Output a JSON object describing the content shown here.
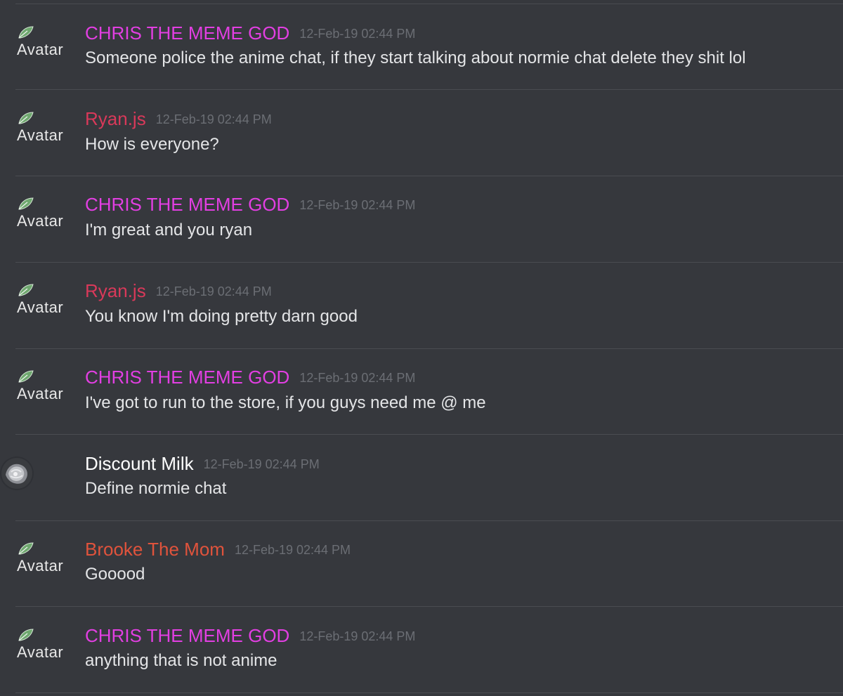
{
  "colors": {
    "background": "#36383d",
    "divider": "#4a4c51",
    "timestamp": "#6b6e74",
    "message_text": "#e4e5e7",
    "user_chris": "#e23fe2",
    "user_ryan": "#d9395a",
    "user_discount_milk": "#ffffff",
    "user_brooke": "#e0533c"
  },
  "avatar_alt": "Avatar",
  "messages": [
    {
      "username": "CHRIS THE MEME GOD",
      "username_color": "#e23fe2",
      "timestamp": "12-Feb-19 02:44 PM",
      "text": "Someone police the anime chat, if they start talking about normie chat delete they shit lol",
      "avatar": "broken-image-icon"
    },
    {
      "username": "Ryan.js",
      "username_color": "#d9395a",
      "timestamp": "12-Feb-19 02:44 PM",
      "text": "How is everyone?",
      "avatar": "broken-image-icon"
    },
    {
      "username": "CHRIS THE MEME GOD",
      "username_color": "#e23fe2",
      "timestamp": "12-Feb-19 02:44 PM",
      "text": "I'm great and you ryan",
      "avatar": "broken-image-icon"
    },
    {
      "username": "Ryan.js",
      "username_color": "#d9395a",
      "timestamp": "12-Feb-19 02:44 PM",
      "text": "You know I'm doing pretty darn good",
      "avatar": "broken-image-icon"
    },
    {
      "username": "CHRIS THE MEME GOD",
      "username_color": "#e23fe2",
      "timestamp": "12-Feb-19 02:44 PM",
      "text": "I've got to run to the store, if you guys need me @ me",
      "avatar": "broken-image-icon"
    },
    {
      "username": "Discount Milk",
      "username_color": "#ffffff",
      "timestamp": "12-Feb-19 02:44 PM",
      "text": "Define normie chat",
      "avatar": "user-photo"
    },
    {
      "username": "Brooke The Mom",
      "username_color": "#e0533c",
      "timestamp": "12-Feb-19 02:44 PM",
      "text": "Gooood",
      "avatar": "broken-image-icon"
    },
    {
      "username": "CHRIS THE MEME GOD",
      "username_color": "#e23fe2",
      "timestamp": "12-Feb-19 02:44 PM",
      "text": "anything that is not anime",
      "avatar": "broken-image-icon"
    }
  ]
}
